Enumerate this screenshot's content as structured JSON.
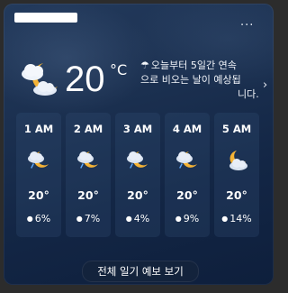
{
  "widget": {
    "more_label": "···",
    "current": {
      "icon": "partly-cloudy-night-icon",
      "temperature": "20",
      "unit": "°C"
    },
    "alert": {
      "icon": "umbrella-icon",
      "line1": "오늘부터 5일간 연속",
      "line2": "으로 비오는 날이 예상됩",
      "line3": "니다.",
      "chevron": "›"
    },
    "hourly": [
      {
        "time": "1 AM",
        "icon": "partly-cloudy-night-rain-icon",
        "temp": "20°",
        "precip": "6%"
      },
      {
        "time": "2 AM",
        "icon": "partly-cloudy-night-rain-icon",
        "temp": "20°",
        "precip": "7%"
      },
      {
        "time": "3 AM",
        "icon": "partly-cloudy-night-rain-icon",
        "temp": "20°",
        "precip": "4%"
      },
      {
        "time": "4 AM",
        "icon": "partly-cloudy-night-rain-icon",
        "temp": "20°",
        "precip": "9%"
      },
      {
        "time": "5 AM",
        "icon": "partly-cloudy-night-icon",
        "temp": "20°",
        "precip": "14%"
      }
    ],
    "drop_icon": "💧",
    "forecast_button": "전체 일기 예보 보기"
  }
}
